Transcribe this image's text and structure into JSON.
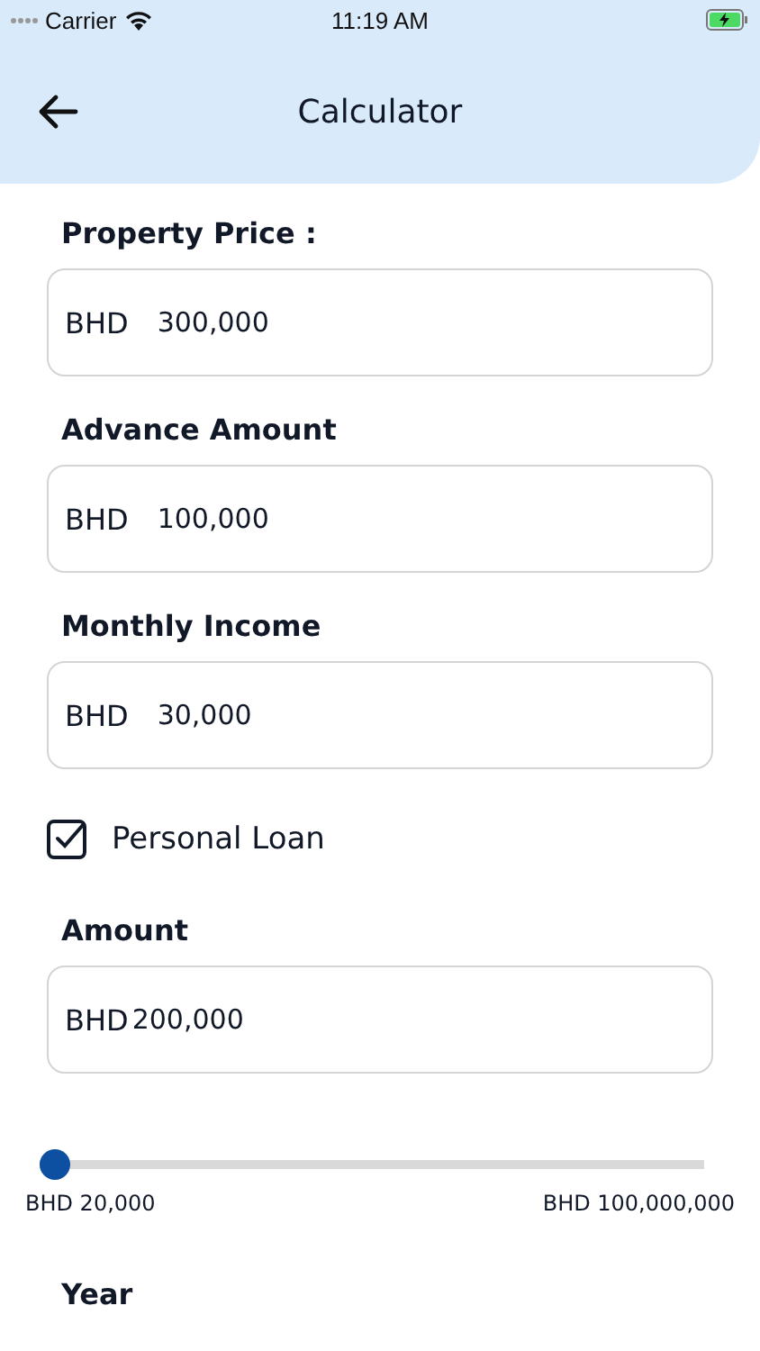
{
  "status_bar": {
    "carrier": "Carrier",
    "time": "11:19 AM"
  },
  "header": {
    "title": "Calculator"
  },
  "fields": [
    {
      "label": "Property Price :",
      "currency": "BHD",
      "value": "300,000"
    },
    {
      "label": "Advance Amount",
      "currency": "BHD",
      "value": "100,000"
    },
    {
      "label": "Monthly Income",
      "currency": "BHD",
      "value": "30,000"
    }
  ],
  "personal_loan": {
    "label": "Personal Loan",
    "checked": true
  },
  "amount": {
    "label": "Amount",
    "currency": "BHD",
    "value": "200,000"
  },
  "slider": {
    "level": 0,
    "min_label": "BHD 20,000",
    "max_label": "BHD 100,000,000"
  },
  "year": {
    "label": "Year"
  }
}
